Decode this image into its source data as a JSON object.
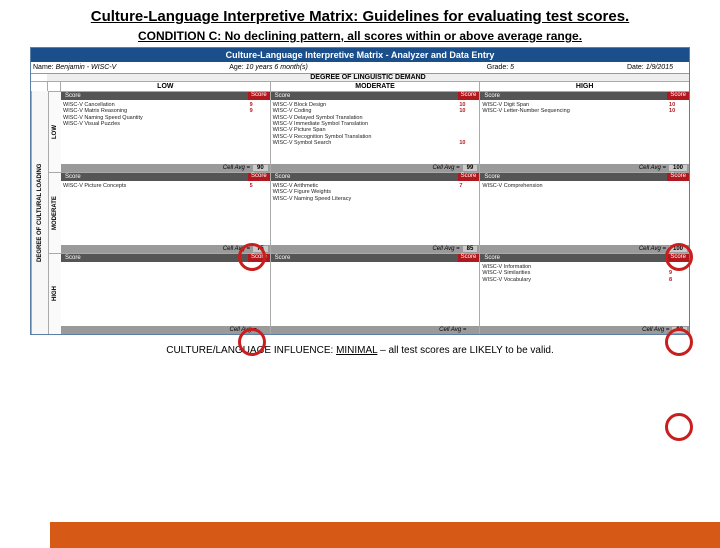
{
  "title": "Culture-Language Interpretive Matrix: Guidelines for evaluating test scores.",
  "subtitle": "CONDITION C: No declining pattern, all scores within or above average range.",
  "banner": "Culture-Language Interpretive Matrix  - Analyzer and Data Entry",
  "header": {
    "name_lbl": "Name:",
    "name_val": "Benjamin - WISC-V",
    "age_lbl": "Age:",
    "age_val": "10 years 6 month(s)",
    "grade_lbl": "Grade:",
    "grade_val": "5",
    "date_lbl": "Date:",
    "date_val": "1/9/2015"
  },
  "demand_title": "DEGREE OF LINGUISTIC DEMAND",
  "yaxis_title": "DEGREE OF CULTURAL LOADING",
  "cols": {
    "low": "LOW",
    "mod": "MODERATE",
    "high": "HIGH"
  },
  "rows": {
    "low": "LOW",
    "mod": "MODERATE",
    "high": "HIGH"
  },
  "score_lbl": "Score",
  "avg_lbl": "Cell Avg =",
  "cells": {
    "low_low": {
      "tests": [
        {
          "n": "WISC-V Cancellation",
          "s": "9"
        },
        {
          "n": "WISC-V Matrix Reasoning",
          "s": "9"
        },
        {
          "n": "WISC-V Naming Speed Quantity",
          "s": ""
        },
        {
          "n": "WISC-V Visual Puzzles",
          "s": ""
        }
      ],
      "avg": "90"
    },
    "low_mod": {
      "tests": [
        {
          "n": "WISC-V Block Design",
          "s": "10"
        },
        {
          "n": "WISC-V Coding",
          "s": "10"
        },
        {
          "n": "WISC-V Delayed Symbol Translation",
          "s": ""
        },
        {
          "n": "WISC-V Immediate Symbol Translation",
          "s": ""
        },
        {
          "n": "WISC-V Picture Span",
          "s": ""
        },
        {
          "n": "WISC-V Recognition Symbol Translation",
          "s": ""
        },
        {
          "n": "WISC-V Symbol Search",
          "s": "10"
        }
      ],
      "avg": "99"
    },
    "low_high": {
      "tests": [
        {
          "n": "WISC-V Digit Span",
          "s": "10"
        },
        {
          "n": "WISC-V Letter-Number Sequencing",
          "s": "10"
        }
      ],
      "avg": "100"
    },
    "mod_low": {
      "tests": [
        {
          "n": "WISC-V Picture Concepts",
          "s": "5"
        }
      ],
      "avg": "75"
    },
    "mod_mod": {
      "tests": [
        {
          "n": "WISC-V Arithmetic",
          "s": "7"
        },
        {
          "n": "WISC-V Figure Weights",
          "s": ""
        },
        {
          "n": "WISC-V Naming Speed Literacy",
          "s": ""
        }
      ],
      "avg": "85"
    },
    "mod_high": {
      "tests": [
        {
          "n": "WISC-V Comprehension",
          "s": ""
        }
      ],
      "avg": "100"
    },
    "high_low": {
      "tests": [],
      "avg": ""
    },
    "high_mod": {
      "tests": [],
      "avg": ""
    },
    "high_high": {
      "tests": [
        {
          "n": "WISC-V Information",
          "s": ""
        },
        {
          "n": "WISC-V Similarities",
          "s": "9"
        },
        {
          "n": "WISC-V Vocabulary",
          "s": "8"
        }
      ],
      "avg": "93"
    }
  },
  "footer": {
    "prefix": "CULTURE/LANGUAGE INFLUENCE: ",
    "level": "MINIMAL",
    "suffix": " – all test scores are LIKELY to be valid."
  }
}
